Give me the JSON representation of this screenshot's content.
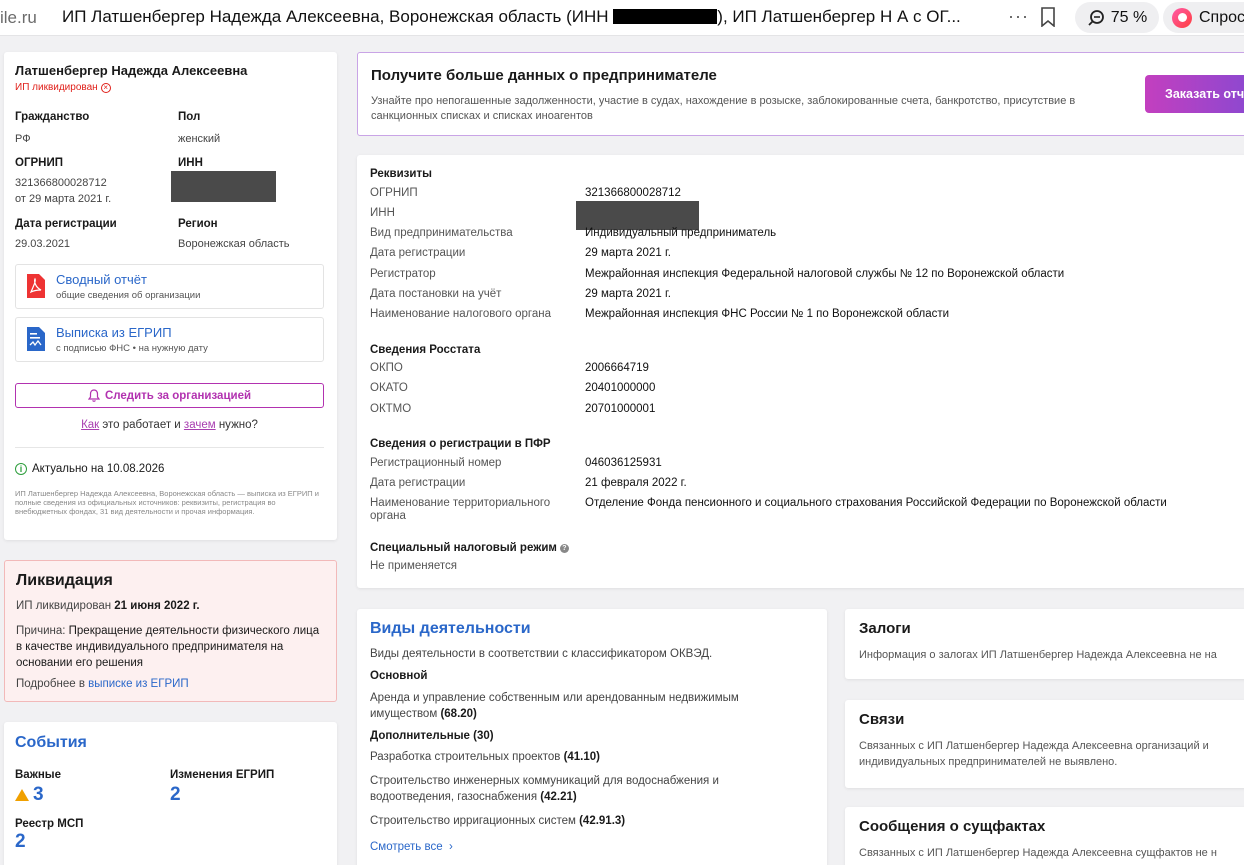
{
  "browser": {
    "domain": "ile.ru",
    "title_part1": "ИП Латшенбергер Надежда Алексеевна, Воронежская область (ИНН ",
    "title_part2": "), ИП Латшенбергер Н А с ОГ...",
    "zoom": "75 %",
    "ask": "Спрос"
  },
  "profile": {
    "name": "Латшенбергер Надежда Алексеевна",
    "status": "ИП ликвидирован",
    "citizenship_label": "Гражданство",
    "citizenship": "РФ",
    "sex_label": "Пол",
    "sex": "женский",
    "ogrnip_label": "ОГРНИП",
    "ogrnip": "321366800028712",
    "ogrnip_date": "от 29 марта 2021 г.",
    "inn_label": "ИНН",
    "regdate_label": "Дата регистрации",
    "regdate": "29.03.2021",
    "region_label": "Регион",
    "region": "Воронежская область",
    "report_title": "Сводный отчёт",
    "report_sub": "общие сведения об организации",
    "extract_title": "Выписка из ЕГРИП",
    "extract_sub": "с подписью ФНС • на нужную дату",
    "follow": "Следить за организацией",
    "how_a": "Как",
    "how_mid": " это работает и ",
    "how_b": "зачем",
    "how_end": " нужно?",
    "actual": "Актуально на 10.08.2026",
    "desc": "ИП Латшенбергер Надежда Алексеевна, Воронежская область — выписка из ЕГРИП и полные сведения из официальных источников: реквизиты, регистрация во внебюджетных фондах, 31 вид деятельности и прочая информация."
  },
  "liquidation": {
    "title": "Ликвидация",
    "line1_a": "ИП ликвидирован ",
    "line1_b": "21 июня 2022 г.",
    "reason_label": "Причина: ",
    "reason": "Прекращение деятельности физического лица в качестве индивидуального предпринимателя на основании его решения",
    "more_a": "Подробнее в ",
    "more_link": "выписке из ЕГРИП"
  },
  "events": {
    "title": "События",
    "important_label": "Важные",
    "important": "3",
    "changes_label": "Изменения ЕГРИП",
    "changes": "2",
    "msp_label": "Реестр МСП",
    "msp": "2"
  },
  "promo": {
    "title": "Получите больше данных о предпринимателе",
    "desc": "Узнайте про непогашенные задолженности, участие в судах, нахождение в розыске, заблокированные счета, банкротство, присутствие в санкционных списках и списках иноагентов",
    "button": "Заказать отчёт"
  },
  "requisites": {
    "title": "Реквизиты",
    "rows": [
      {
        "k": "ОГРНИП",
        "v": "321366800028712"
      },
      {
        "k": "ИНН",
        "v": ""
      },
      {
        "k": "Вид предпринимательства",
        "v": "Индивидуальный предприниматель"
      },
      {
        "k": "Дата регистрации",
        "v": "29 марта 2021 г."
      },
      {
        "k": "Регистратор",
        "v": "Межрайонная инспекция Федеральной налоговой службы № 12 по Воронежской области"
      },
      {
        "k": "Дата постановки на учёт",
        "v": "29 марта 2021 г."
      },
      {
        "k": "Наименование налогового органа",
        "v": "Межрайонная инспекция ФНС России № 1 по Воронежской области"
      }
    ],
    "rosstat_title": "Сведения Росстата",
    "rosstat": [
      {
        "k": "ОКПО",
        "v": "2006664719"
      },
      {
        "k": "ОКАТО",
        "v": "20401000000"
      },
      {
        "k": "ОКТМО",
        "v": "20701000001"
      }
    ],
    "pfr_title": "Сведения о регистрации в ПФР",
    "pfr": [
      {
        "k": "Регистрационный номер",
        "v": "046036125931"
      },
      {
        "k": "Дата регистрации",
        "v": "21 февраля 2022 г."
      },
      {
        "k": "Наименование территориального органа",
        "v": "Отделение Фонда пенсионного и социального страхования Российской Федерации по Воронежской области"
      }
    ],
    "tax_title": "Специальный налоговый режим",
    "tax": "Не применяется"
  },
  "activities": {
    "title": "Виды деятельности",
    "subtitle": "Виды деятельности в соответствии с классификатором ОКВЭД.",
    "main_label": "Основной",
    "main": "Аренда и управление собственным или арендованным недвижимым имуществом",
    "main_code": "(68.20)",
    "extra_label": "Дополнительные (30)",
    "extra": [
      {
        "t": "Разработка строительных проектов ",
        "c": "(41.10)"
      },
      {
        "t": "Строительство инженерных коммуникаций для водоснабжения и водоотведения, газоснабжения ",
        "c": "(42.21)"
      },
      {
        "t": "Строительство ирригационных систем ",
        "c": "(42.91.3)"
      }
    ],
    "more": "Смотреть все"
  },
  "pledges": {
    "title": "Залоги",
    "desc": "Информация о залогах ИП Латшенбергер Надежда Алексеевна не на"
  },
  "links": {
    "title": "Связи",
    "desc1": "Связанных с ИП Латшенбергер Надежда Алексеевна организаций и",
    "desc2": "индивидуальных предпринимателей не выявлено."
  },
  "facts": {
    "title": "Сообщения о сущфактах",
    "desc": "Связанных с ИП Латшенбергер Надежда Алексеевна сущфактов не н"
  }
}
